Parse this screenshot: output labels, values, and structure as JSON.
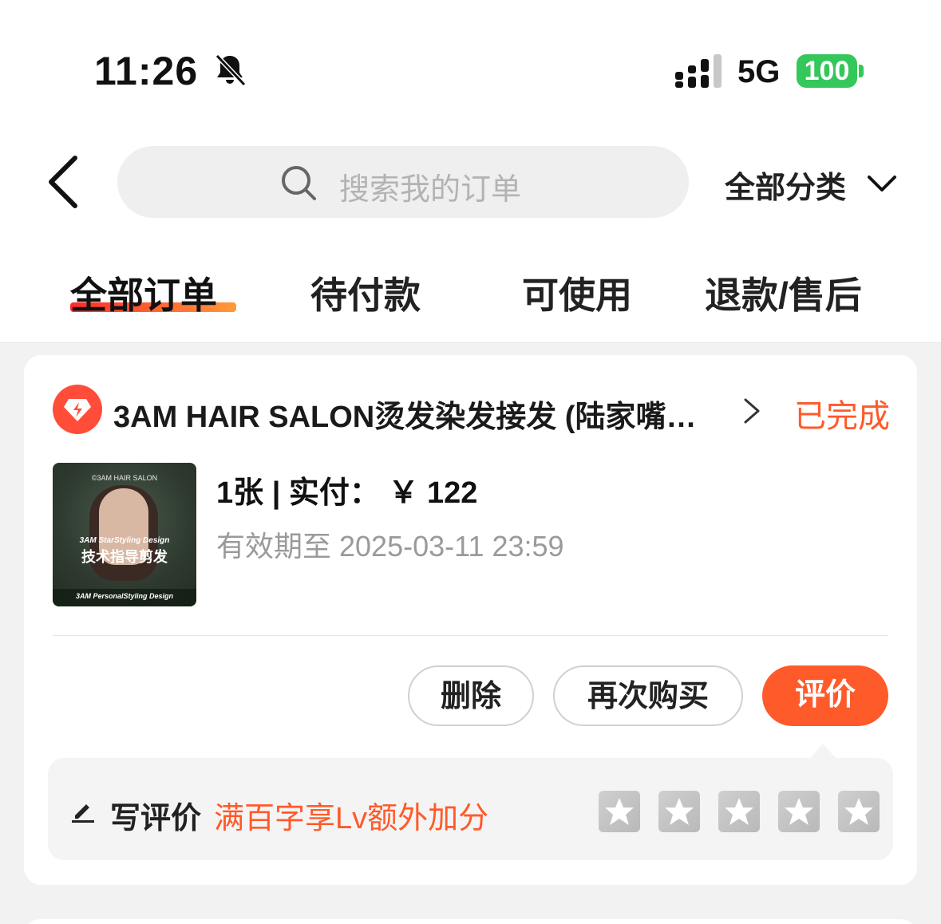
{
  "status_bar": {
    "time": "11:26",
    "network": "5G",
    "battery": "100",
    "icons": [
      "bell-slash-icon",
      "signal-icon",
      "battery-icon"
    ]
  },
  "nav": {
    "search_placeholder": "搜索我的订单",
    "category": "全部分类"
  },
  "tabs": [
    {
      "label": "全部订单",
      "active": true
    },
    {
      "label": "待付款",
      "active": false
    },
    {
      "label": "可使用",
      "active": false
    },
    {
      "label": "退款/售后",
      "active": false
    }
  ],
  "order": {
    "shop_name": "3AM HAIR SALON烫发染发接发 (陆家嘴…",
    "status": "已完成",
    "thumbnail": {
      "brand": "©3AM HAIR SALON",
      "subtitle": "3AM StarStyling Design",
      "title": "技术指导剪发",
      "footer": "3AM PersonalStyling Design"
    },
    "quantity_price": "1张 | 实付： ￥ 122",
    "validity": "有效期至 2025-03-11 23:59",
    "buttons": {
      "delete": "删除",
      "rebuy": "再次购买",
      "review": "评价"
    },
    "review": {
      "label": "写评价",
      "hint": "满百字享Lv额外加分",
      "stars": 5
    }
  },
  "colors": {
    "accent": "#ff5a2a",
    "battery": "#34c759"
  }
}
